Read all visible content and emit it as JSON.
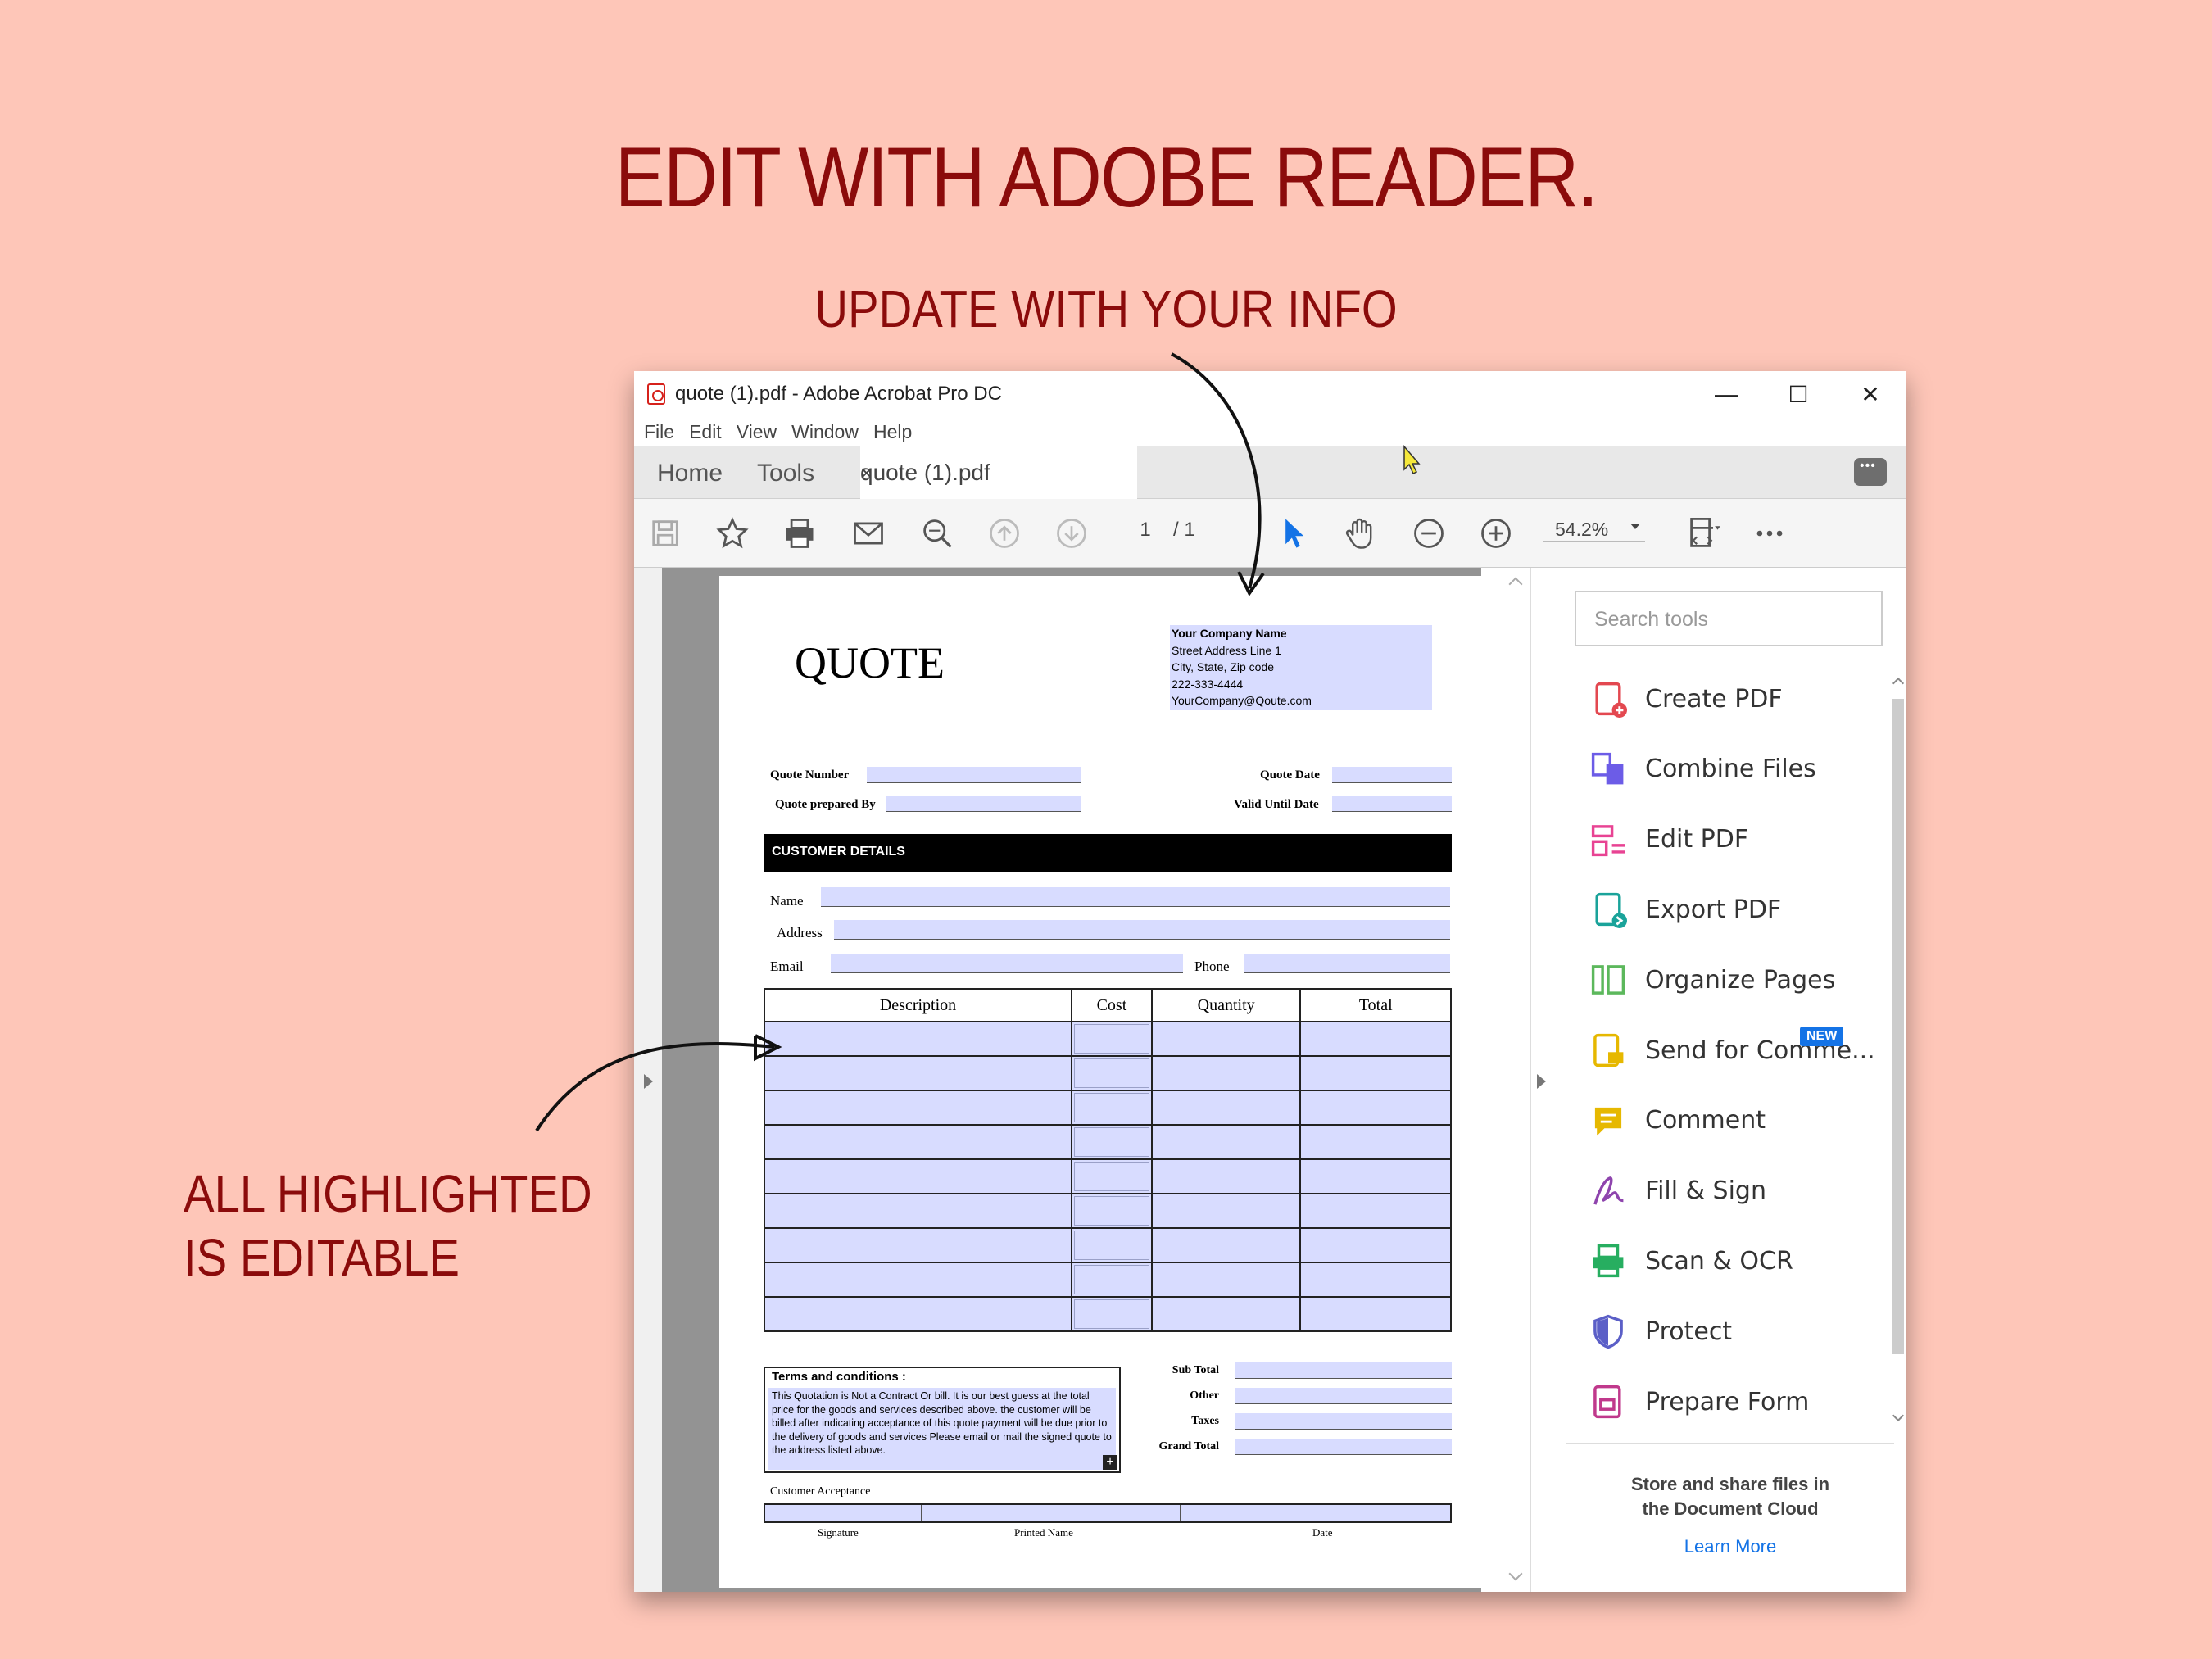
{
  "headline": "EDIT WITH ADOBE READER.",
  "subhead": "UPDATE WITH YOUR INFO",
  "side_note": [
    "ALL HIGHLIGHTED",
    "IS EDITABLE"
  ],
  "window": {
    "title": "quote (1).pdf - Adobe Acrobat Pro DC",
    "controls": [
      "—",
      "☐",
      "✕"
    ]
  },
  "menu": [
    "File",
    "Edit",
    "View",
    "Window",
    "Help"
  ],
  "tabs": {
    "home": "Home",
    "tools": "Tools",
    "document": "quote (1).pdf",
    "close": "×"
  },
  "toolbar": {
    "page_current": "1",
    "page_total": "/ 1",
    "zoom": "54.2%",
    "icons": [
      "save-icon",
      "star-icon",
      "print-icon",
      "mail-icon",
      "search-icon",
      "page-up-icon",
      "page-down-icon",
      "pointer-icon",
      "hand-icon",
      "zoom-out-icon",
      "zoom-in-icon",
      "fit-page-icon",
      "more-icon"
    ]
  },
  "document": {
    "heading": "QUOTE",
    "company": [
      "Your Company Name",
      "Street Address Line 1",
      "City, State, Zip code",
      "222-333-4444",
      "YourCompany@Qoute.com"
    ],
    "quote_number_label": "Quote Number",
    "quote_prepared_label": "Quote prepared By",
    "quote_date_label": "Quote Date",
    "valid_until_label": "Valid Until Date",
    "customer_details": "CUSTOMER DETAILS",
    "name_label": "Name",
    "address_label": "Address",
    "email_label": "Email",
    "phone_label": "Phone",
    "table_headers": [
      "Description",
      "Cost",
      "Quantity",
      "Total"
    ],
    "table_rows": 9,
    "terms_title": "Terms and conditions :",
    "terms_body": "This Quotation is Not a Contract Or bill. It is our best guess at the total price for the goods and services described above. the customer will be billed after indicating acceptance of this quote payment will be due prior to the delivery of goods and services Please email or mail the signed quote to the address listed above.",
    "terms_plus": "+",
    "totals": [
      "Sub Total",
      "Other",
      "Taxes",
      "Grand Total"
    ],
    "acceptance_label": "Customer Acceptance",
    "sig_labels": [
      "Signature",
      "Printed Name",
      "Date"
    ]
  },
  "tools_pane": {
    "search_placeholder": "Search tools",
    "items": [
      {
        "label": "Create PDF",
        "icon": "create-pdf-icon",
        "color": "#e34850"
      },
      {
        "label": "Combine Files",
        "icon": "combine-files-icon",
        "color": "#6c5ce7"
      },
      {
        "label": "Edit PDF",
        "icon": "edit-pdf-icon",
        "color": "#e84393"
      },
      {
        "label": "Export PDF",
        "icon": "export-pdf-icon",
        "color": "#1aa39a"
      },
      {
        "label": "Organize Pages",
        "icon": "organize-pages-icon",
        "color": "#5cb85c"
      },
      {
        "label": "Send for Comme...",
        "icon": "send-comment-icon",
        "color": "#e6b800"
      },
      {
        "label": "Comment",
        "icon": "comment-icon",
        "color": "#e6b800"
      },
      {
        "label": "Fill & Sign",
        "icon": "fill-sign-icon",
        "color": "#8e44ad"
      },
      {
        "label": "Scan & OCR",
        "icon": "scan-ocr-icon",
        "color": "#27ae60"
      },
      {
        "label": "Protect",
        "icon": "protect-icon",
        "color": "#5b5fc7"
      },
      {
        "label": "Prepare Form",
        "icon": "prepare-form-icon",
        "color": "#c0398c"
      }
    ],
    "new_badge": "NEW",
    "cloud_text": "Store and share files in the Document Cloud",
    "learn_more": "Learn More"
  },
  "colors": {
    "background": "#fec6b8",
    "headline": "#8b0b0b",
    "field_highlight": "#d8dcff",
    "accent_blue": "#1473e6"
  }
}
